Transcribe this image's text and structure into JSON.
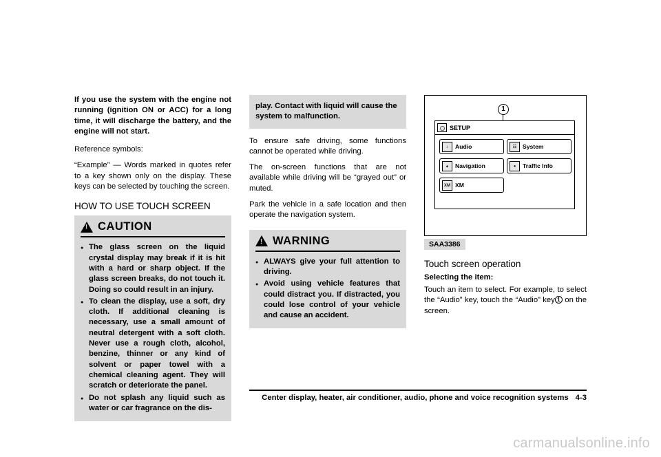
{
  "column1": {
    "intro_bold": "If you use the system with the engine not running (ignition ON or ACC) for a long time, it will discharge the battery, and the engine will not start.",
    "ref_symbols": "Reference symbols:",
    "example_para": "“Example” — Words marked in quotes refer to a key shown only on the display. These keys can be selected by touching the screen.",
    "heading": "HOW TO USE TOUCH SCREEN",
    "caution": {
      "title": "CAUTION",
      "icon": "warning-triangle-icon",
      "items": [
        "The glass screen on the liquid crystal display may break if it is hit with a hard or sharp object. If the glass screen breaks, do not touch it. Doing so could result in an injury.",
        "To clean the display, use a soft, dry cloth. If additional cleaning is necessary, use a small amount of neutral detergent with a soft cloth. Never use a rough cloth, alcohol, benzine, thinner or any kind of solvent or paper towel with a chemical cleaning agent. They will scratch or deteriorate the panel.",
        "Do not splash any liquid such as water or car fragrance on the dis-"
      ]
    }
  },
  "column2": {
    "continued_bold": "play. Contact with liquid will cause the system to malfunction.",
    "para1": "To ensure safe driving, some functions cannot be operated while driving.",
    "para2": "The on-screen functions that are not available while driving will be “grayed out” or muted.",
    "para3": "Park the vehicle in a safe location and then operate the navigation system.",
    "warning": {
      "title": "WARNING",
      "icon": "warning-triangle-icon",
      "items": [
        "ALWAYS give your full attention to driving.",
        "Avoid using vehicle features that could distract you. If distracted, you could lose control of your vehicle and cause an accident."
      ]
    }
  },
  "column3": {
    "figure": {
      "callout": "1",
      "header_label": "SETUP",
      "header_icon": "setup-icon",
      "keys": [
        {
          "label": "Audio",
          "icon": "audio-note-icon"
        },
        {
          "label": "System",
          "icon": "system-icon"
        },
        {
          "label": "Navigation",
          "icon": "navigation-arrow-icon"
        },
        {
          "label": "Traffic Info",
          "icon": "traffic-info-icon"
        },
        {
          "label": "XM",
          "icon": "xm-icon"
        }
      ],
      "figure_id": "SAA3386"
    },
    "caption": "Touch screen operation",
    "sub_heading": "Selecting the item:",
    "body_a": "Touch an item to select. For example, to select the “Audio” key, touch the “Audio” key",
    "body_b": "on the screen.",
    "inline_callout": "1"
  },
  "footer": {
    "text": "Center display, heater, air conditioner, audio, phone and voice recognition systems",
    "page": "4-3"
  },
  "watermark": "carmanualsonline.info"
}
